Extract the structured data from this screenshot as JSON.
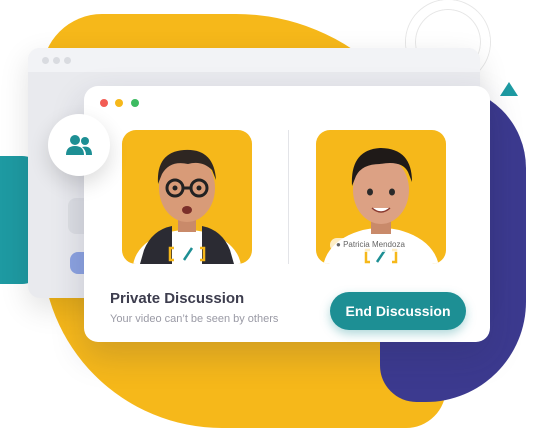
{
  "call": {
    "title": "Private Discussion",
    "subtitle": "Your video can’t be seen by others",
    "end_button_label": "End Discussion",
    "participant_name": "Patricia Mendoza"
  },
  "icons": {
    "participants_badge": "people-icon"
  },
  "colors": {
    "accent_teal": "#1d8f94",
    "brand_yellow": "#f6b81a",
    "navy": "#3c3a8f",
    "dot_red": "#f25c54",
    "dot_yellow": "#f6b81a",
    "dot_green": "#3dbb61"
  }
}
